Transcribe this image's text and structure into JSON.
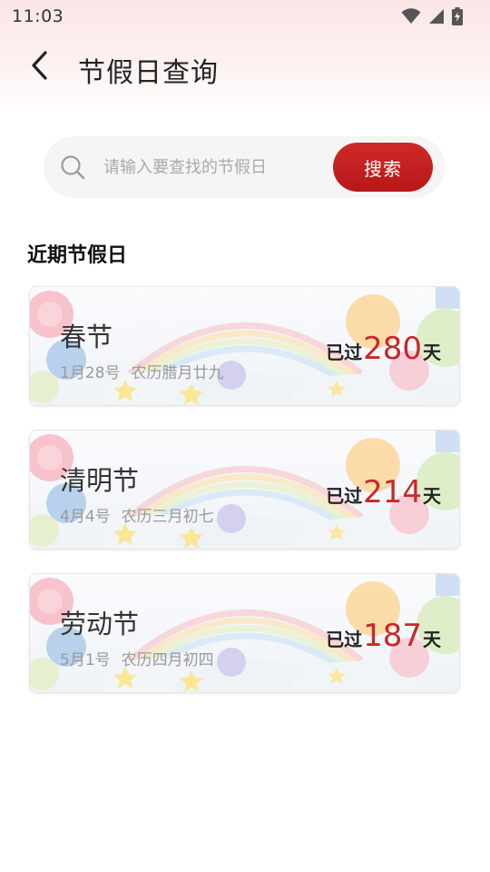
{
  "status_bar": {
    "time": "11:03",
    "icons": [
      "wifi-icon",
      "cell-signal-icon",
      "battery-charging-icon"
    ]
  },
  "header": {
    "back_icon": "chevron-left-icon",
    "title": "节假日查询"
  },
  "search": {
    "placeholder": "请输入要查找的节假日",
    "value": "",
    "icon": "search-icon",
    "button_label": "搜索"
  },
  "section": {
    "title": "近期节假日"
  },
  "holidays": [
    {
      "name": "春节",
      "date": "1月28号",
      "lunar": "农历腊月廿九",
      "prefix": "已过",
      "days": "280",
      "suffix": "天"
    },
    {
      "name": "清明节",
      "date": "4月4号",
      "lunar": "农历三月初七",
      "prefix": "已过",
      "days": "214",
      "suffix": "天"
    },
    {
      "name": "劳动节",
      "date": "5月1号",
      "lunar": "农历四月初四",
      "prefix": "已过",
      "days": "187",
      "suffix": "天"
    }
  ],
  "colors": {
    "accent": "#c8282a",
    "button": "#b71718",
    "header_tint": "#fbe6e6"
  }
}
